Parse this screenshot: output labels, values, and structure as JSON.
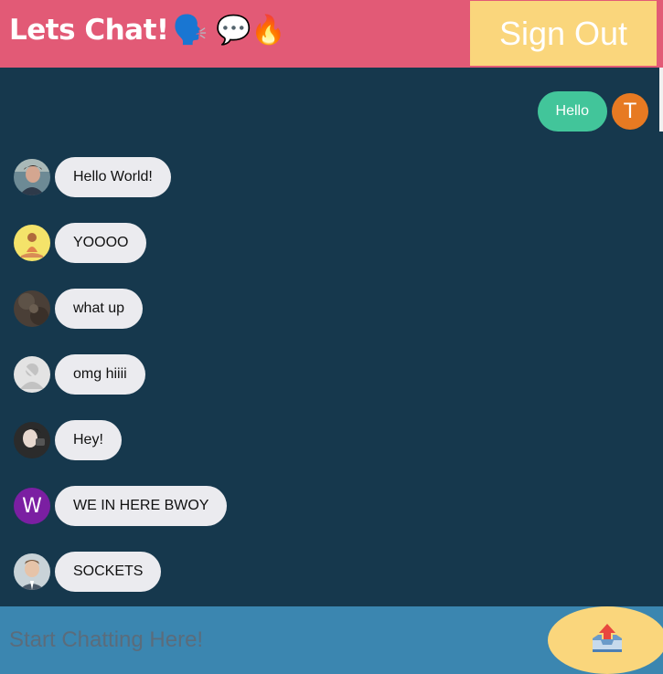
{
  "header": {
    "title": "Lets Chat!",
    "title_emoji": "🗣️ 💬🔥",
    "signout_label": "Sign Out"
  },
  "own_message": {
    "text": "Hello",
    "avatar_letter": "T",
    "avatar_color": "#e77a22",
    "bubble_color": "#42c59a"
  },
  "messages": [
    {
      "text": "Hello World!",
      "avatar": "photo-man-with-hat"
    },
    {
      "text": "YOOOO",
      "avatar": "photo-person-yellow"
    },
    {
      "text": "what up",
      "avatar": "photo-dark-outdoor"
    },
    {
      "text": "omg hiiii",
      "avatar": "default-person-placeholder"
    },
    {
      "text": "Hey!",
      "avatar": "photo-person-dark-hair"
    },
    {
      "text": "WE IN HERE BWOY",
      "avatar_letter": "W",
      "avatar_color": "#7b1fa2"
    },
    {
      "text": "SOCKETS",
      "avatar": "photo-man-suit"
    }
  ],
  "composer": {
    "placeholder": "Start Chatting Here!",
    "send_icon": "outbox-tray-icon"
  },
  "colors": {
    "header": "#e25a76",
    "signout": "#fad67c",
    "background": "#16384d",
    "composer": "#3b86b0"
  }
}
